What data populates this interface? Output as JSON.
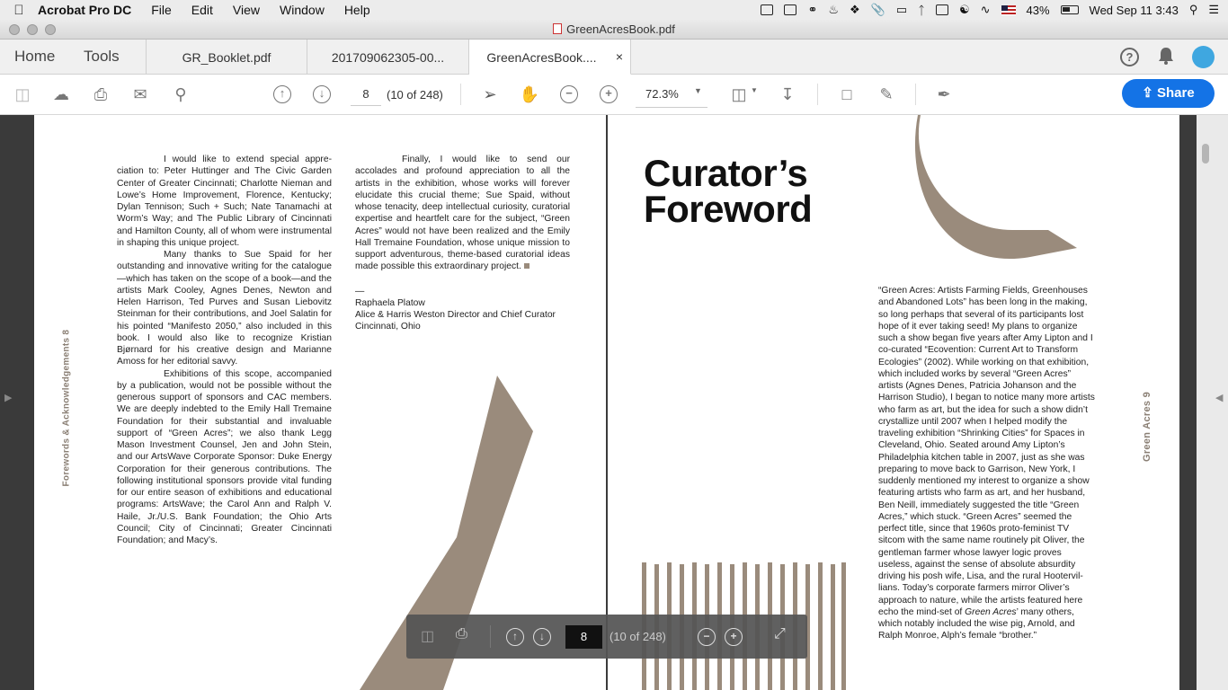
{
  "menubar": {
    "app_name": "Acrobat Pro DC",
    "items": [
      "File",
      "Edit",
      "View",
      "Window",
      "Help"
    ],
    "battery": "43%",
    "clock": "Wed Sep 11  3:43"
  },
  "window": {
    "title": "GreenAcresBook.pdf"
  },
  "tabs": {
    "home": "Home",
    "tools": "Tools",
    "docs": [
      {
        "label": "GR_Booklet.pdf"
      },
      {
        "label": "201709062305-00..."
      },
      {
        "label": "GreenAcresBook...."
      }
    ],
    "close": "×"
  },
  "toolbar": {
    "page_value": "8",
    "page_count": "(10 of 248)",
    "zoom": "72.3%",
    "share_label": "Share"
  },
  "left_page": {
    "running_head": "Forewords & Acknowledgements    8",
    "col1": [
      "I would like to extend special appre­ciation to: Peter Huttinger and The Civic Garden Center of Greater Cincinnati; Charlotte Nieman and Lowe’s Home Improvement, Florence, Kentucky; Dylan Tennison; Such + Such; Nate Tanamachi at Worm’s Way; and The Public Library of Cincinnati and Hamilton County, all of whom were instrumental in shaping this unique project.",
      "Many thanks to Sue Spaid for her outstanding and innovative writing for the cata­logue—which has taken on the scope of a book—and the artists Mark Cooley, Agnes Denes, Newton and Helen Harrison, Ted Purves and Susan Liebovitz Steinman for their contributions, and Joel Salatin for his pointed “Manifesto 2050,” also included in this book. I would also like to recognize Kristian Bjørnard for his creative design and Marianne Amoss for her editorial savvy.",
      "Exhibitions of this scope, accom­panied by a publication, would not be possible without the generous support of sponsors and CAC members. We are deeply indebted to the Emily Hall Tremaine Foundation for their substan­tial and invaluable support of “Green Acres”; we also thank Legg Mason Investment Counsel, Jen and John Stein, and our ArtsWave Corporate Sponsor: Duke Energy Corporation for their generous contributions. The following institu­tional sponsors provide vital funding for our entire season of exhibitions and educational programs: ArtsWave; the Carol Ann and Ralph V. Haile, Jr./U.S. Bank Foundation; the Ohio Arts Council; City of Cincinnati; Greater Cincinnati Foundation; and Macy’s."
    ],
    "col2": "Finally, I would like to send our accolades and profound appreciation to all the artists in the exhibition, whose works will forever elucidate this crucial theme; Sue Spaid, without whose tenacity, deep intellectual curiosity, curato­rial expertise and heartfelt care for the subject, “Green Acres” would not have been realized and the Emily Hall Tremaine Foundation, whose unique mission to support adventurous, theme-based curatorial ideas made possible this extraordinary project.",
    "dash": "—",
    "sig_name": "Raphaela Platow",
    "sig_title": "Alice & Harris Weston Director and Chief Curator",
    "sig_place": "Cincinnati, Ohio"
  },
  "right_page": {
    "title_line1": "Curator’s",
    "title_line2": "Foreword",
    "running_head": "Green Acres    9",
    "body_before": "“Green Acres: Artists Farming Fields, Green­houses and Abandoned Lots” has been long in the making, so long perhaps that several of its participants lost hope of it ever taking seed! My plans to organize such a show began five years after Amy Lipton and I co-curated “Ecovention: Current Art to Transform Ecologies” (2002). While working on that exhibition, which included works by several “Green Acres” artists (Agnes Denes, Patricia Johanson and the Harrison Studio), I began to notice many more artists who farm as art, but the idea for such a show didn’t crystallize until 2007 when I helped modify the traveling exhibi­tion “Shrinking Cities” for Spaces in Cleveland, Ohio. Seated around Amy Lipton’s Philadelphia kitchen table in 2007, just as she was preparing to move back to Garrison, New York, I suddenly mentioned my interest to organize a show featuring artists who farm as art, and her husband, Ben Neill, immediately suggested the title “Green Acres,” which stuck. “Green Acres” seemed the perfect title, since that 1960s proto-feminist TV sitcom with the same name routinely pit Oliver, the gentleman farmer whose lawyer logic proves useless, against the sense of absolute absurdity driving his posh wife, Lisa, and the rural Hootervil­lians. Today’s corporate farmers mirror Oliver’s approach to nature, while the artists featured here echo the mind-set of ",
    "body_italic": "Green Acres",
    "body_after": "’ many others, which notably included the wise pig, Arnold, and Ralph Monroe, Alph’s female “brother.”"
  },
  "floating_toolbar": {
    "page_value": "8",
    "page_count": "(10 of 248)"
  },
  "colors": {
    "share_blue": "#1473e6",
    "art_taupe": "#9a8b7c"
  }
}
